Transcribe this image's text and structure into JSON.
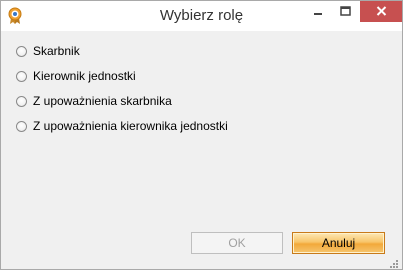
{
  "window": {
    "title": "Wybierz rolę",
    "app_icon": "orange-badge-icon"
  },
  "title_controls": {
    "minimize_icon": "minimize-icon",
    "maximize_icon": "maximize-icon",
    "close_icon": "close-icon",
    "close_color": "#c75050"
  },
  "roles": [
    {
      "label": "Skarbnik",
      "selected": false
    },
    {
      "label": "Kierownik jednostki",
      "selected": false
    },
    {
      "label": "Z upoważnienia skarbnika",
      "selected": false
    },
    {
      "label": "Z upoważnienia kierownika jednostki",
      "selected": false
    }
  ],
  "buttons": {
    "ok_label": "OK",
    "ok_enabled": false,
    "cancel_label": "Anuluj"
  },
  "colors": {
    "accent_button": "#f8c56a",
    "disabled_text": "#a0a0a0"
  }
}
